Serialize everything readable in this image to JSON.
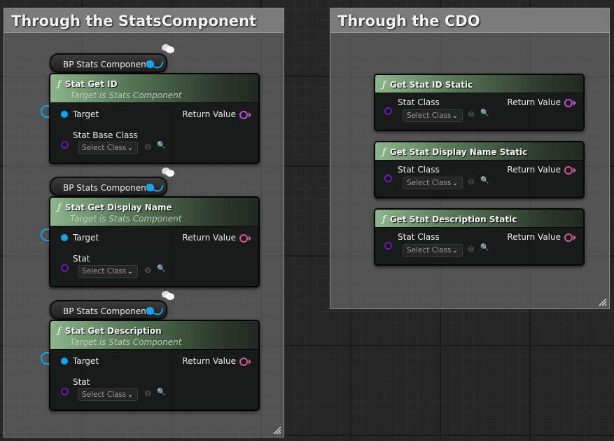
{
  "comments": [
    {
      "title": "Through the StatsComponent"
    },
    {
      "title": "Through the CDO"
    }
  ],
  "component_nodes": [
    {
      "label": "BP Stats Component"
    },
    {
      "label": "BP Stats Component"
    },
    {
      "label": "BP Stats Component"
    }
  ],
  "component_functions": [
    {
      "title": "Stat Get ID",
      "subtitle": "Target is Stats Component",
      "target_label": "Target",
      "return_label": "Return Value",
      "param_label": "Stat Base Class",
      "select_label": "Select Class"
    },
    {
      "title": "Stat Get Display Name",
      "subtitle": "Target is Stats Component",
      "target_label": "Target",
      "return_label": "Return Value",
      "param_label": "Stat",
      "select_label": "Select Class"
    },
    {
      "title": "Stat Get Description",
      "subtitle": "Target is Stats Component",
      "target_label": "Target",
      "return_label": "Return Value",
      "param_label": "Stat",
      "select_label": "Select Class"
    }
  ],
  "cdo_functions": [
    {
      "title": "Get Stat ID Static",
      "param_label": "Stat Class",
      "return_label": "Return Value",
      "select_label": "Select Class"
    },
    {
      "title": "Get Stat Display Name Static",
      "param_label": "Stat Class",
      "return_label": "Return Value",
      "select_label": "Select Class"
    },
    {
      "title": "Get Stat Description Static",
      "param_label": "Stat Class",
      "return_label": "Return Value",
      "select_label": "Select Class"
    }
  ],
  "icons": {
    "function": "ƒ",
    "clear": "⊖",
    "browse": "🔍",
    "chevron": "⌄"
  },
  "colors": {
    "object_pin": "#12a6ef",
    "class_pin": "#6a1ea6",
    "return_pin": "#c050d8"
  }
}
